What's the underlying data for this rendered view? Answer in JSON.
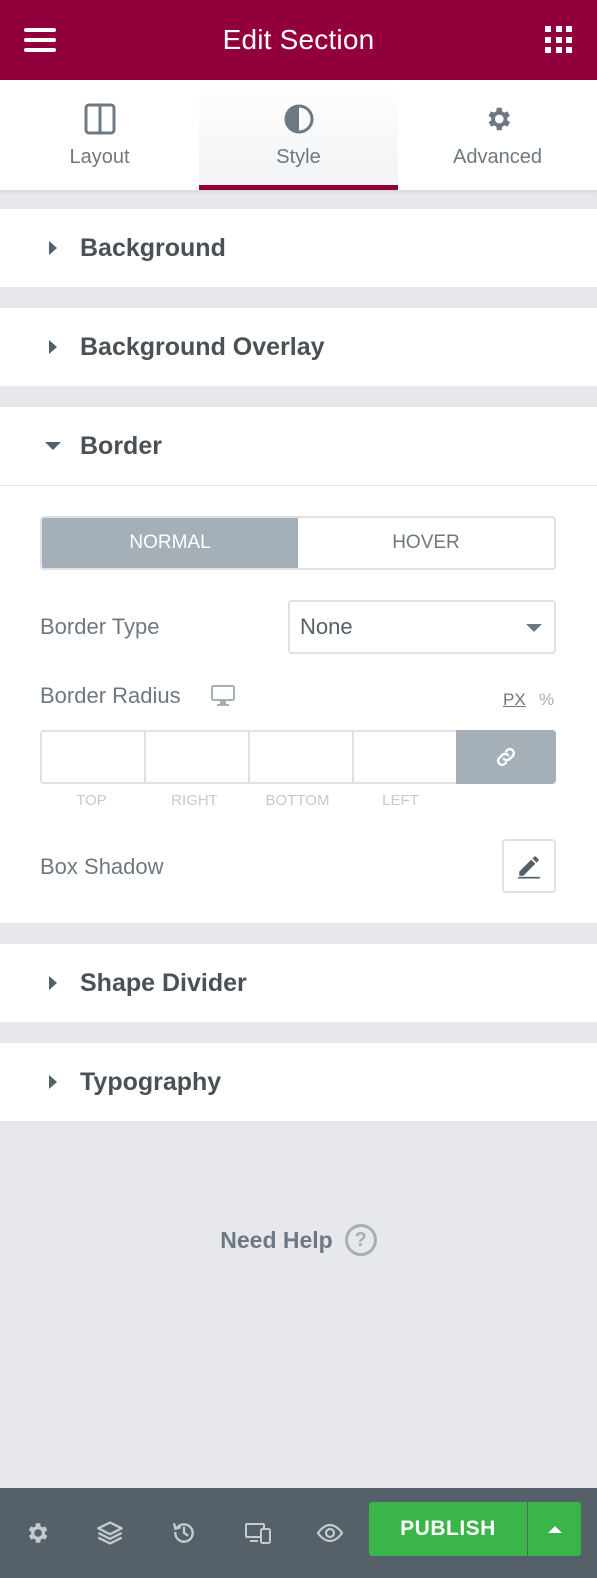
{
  "header": {
    "title": "Edit Section",
    "menu_icon": "hamburger-menu-icon",
    "apps_icon": "grid-apps-icon",
    "color": "#92003b"
  },
  "tabs": [
    {
      "label": "Layout",
      "icon": "columns-icon",
      "active": false
    },
    {
      "label": "Style",
      "icon": "contrast-icon",
      "active": true
    },
    {
      "label": "Advanced",
      "icon": "gear-icon",
      "active": false
    }
  ],
  "sections": {
    "background": {
      "title": "Background",
      "expanded": false
    },
    "background_overlay": {
      "title": "Background Overlay",
      "expanded": false
    },
    "border": {
      "title": "Border",
      "expanded": true,
      "state_toggle": {
        "normal": "NORMAL",
        "hover": "HOVER",
        "selected": "NORMAL"
      },
      "border_type": {
        "label": "Border Type",
        "value": "None"
      },
      "border_radius": {
        "label": "Border Radius",
        "units": {
          "px": "PX",
          "percent": "%",
          "selected": "PX"
        },
        "fields": {
          "top": "TOP",
          "right": "RIGHT",
          "bottom": "BOTTOM",
          "left": "LEFT"
        },
        "values": {
          "top": "",
          "right": "",
          "bottom": "",
          "left": ""
        },
        "linked": true
      },
      "box_shadow": {
        "label": "Box Shadow"
      }
    },
    "shape_divider": {
      "title": "Shape Divider",
      "expanded": false
    },
    "typography": {
      "title": "Typography",
      "expanded": false
    }
  },
  "help": {
    "label": "Need Help",
    "icon_glyph": "?"
  },
  "footer": {
    "icons": [
      "settings-icon",
      "layers-icon",
      "history-icon",
      "responsive-icon",
      "preview-eye-icon"
    ],
    "publish_label": "PUBLISH",
    "publish_color": "#39b54a"
  }
}
